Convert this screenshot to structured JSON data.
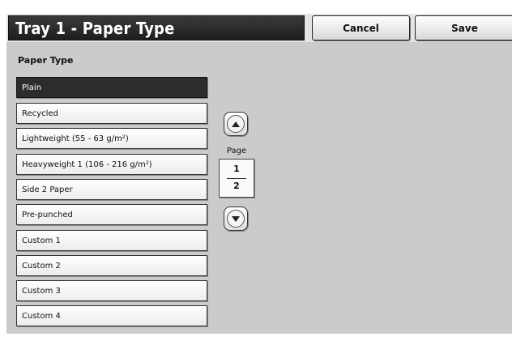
{
  "header": {
    "title": "Tray 1 - Paper Type",
    "cancel_label": "Cancel",
    "save_label": "Save"
  },
  "section": {
    "label": "Paper Type"
  },
  "paper_types": {
    "items": [
      {
        "label": "Plain",
        "selected": true
      },
      {
        "label": "Recycled",
        "selected": false
      },
      {
        "label": "Lightweight (55 - 63 g/m²)",
        "selected": false
      },
      {
        "label": "Heavyweight 1 (106 - 216 g/m²)",
        "selected": false
      },
      {
        "label": "Side 2 Paper",
        "selected": false
      },
      {
        "label": "Pre-punched",
        "selected": false
      },
      {
        "label": "Custom 1",
        "selected": false
      },
      {
        "label": "Custom 2",
        "selected": false
      },
      {
        "label": "Custom 3",
        "selected": false
      },
      {
        "label": "Custom 4",
        "selected": false
      }
    ]
  },
  "pager": {
    "label": "Page",
    "current": "1",
    "total": "2",
    "up_icon": "triangle-up-icon",
    "down_icon": "triangle-down-icon"
  },
  "colors": {
    "selected_bg": "#2c2c2c",
    "panel_bg": "#cbcbcb"
  }
}
